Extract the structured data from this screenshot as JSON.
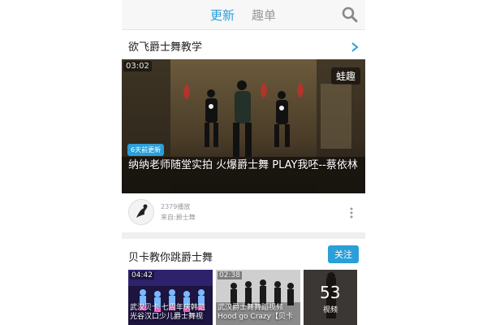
{
  "header": {
    "tabs": [
      {
        "label": "更新",
        "active": true
      },
      {
        "label": "趣单",
        "active": false
      }
    ],
    "search_icon": "search-icon",
    "accent_color": "#2a9fd8"
  },
  "section1": {
    "title": "欲飞爵士舞教学",
    "video": {
      "duration": "03:02",
      "brand_badge": "蛙趣",
      "new_badge": "6天前更新",
      "title": "纳纳老师随堂实拍 火爆爵士舞 PLAY我呸--蔡依林"
    },
    "meta": {
      "plays": "2379播放",
      "source": "来自:爵士舞"
    }
  },
  "section2": {
    "title": "贝卡教你跳爵士舞",
    "follow_label": "关注",
    "thumbs": [
      {
        "duration": "04:42",
        "caption": "武汉贝卡 七周年庆韩范 光谷汉口少儿爵士舞视"
      },
      {
        "duration": "02:38",
        "caption": "武汉爵士舞舞蹈视频 Hood go Crazy【贝卡"
      },
      {
        "count": "53",
        "count_label": "视频"
      }
    ]
  }
}
